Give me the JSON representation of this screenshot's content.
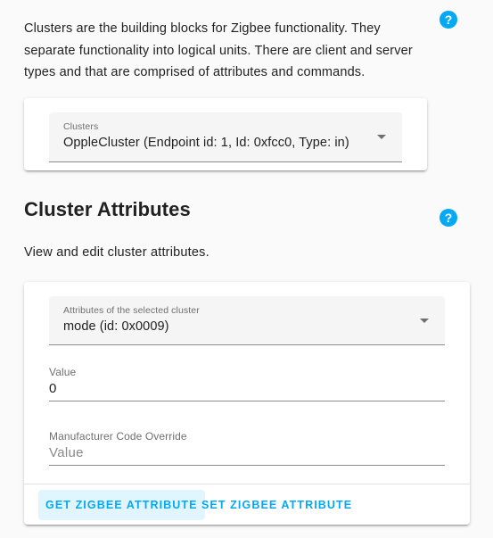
{
  "clusters_section": {
    "description": "Clusters are the building blocks for Zigbee functionality. They separate functionality into logical units. There are client and server types and that are comprised of attributes and commands.",
    "help_icon": "?",
    "select_label": "Clusters",
    "select_value": "OppleCluster (Endpoint id: 1, Id: 0xfcc0, Type: in)"
  },
  "attributes_section": {
    "title": "Cluster Attributes",
    "help_icon": "?",
    "description": "View and edit cluster attributes.",
    "select_label": "Attributes of the selected cluster",
    "select_value": "mode (id: 0x0009)",
    "value_label": "Value",
    "value": "0",
    "manufacturer_label": "Manufacturer Code Override",
    "manufacturer_placeholder": "Value",
    "get_button": "GET ZIGBEE ATTRIBUTE",
    "set_button": "SET ZIGBEE ATTRIBUTE"
  },
  "colors": {
    "accent": "#03a9f4",
    "button_hover_bg": "#e1f5fe"
  },
  "icons": {
    "help": "help-circle-icon",
    "dropdown": "chevron-down-icon"
  }
}
